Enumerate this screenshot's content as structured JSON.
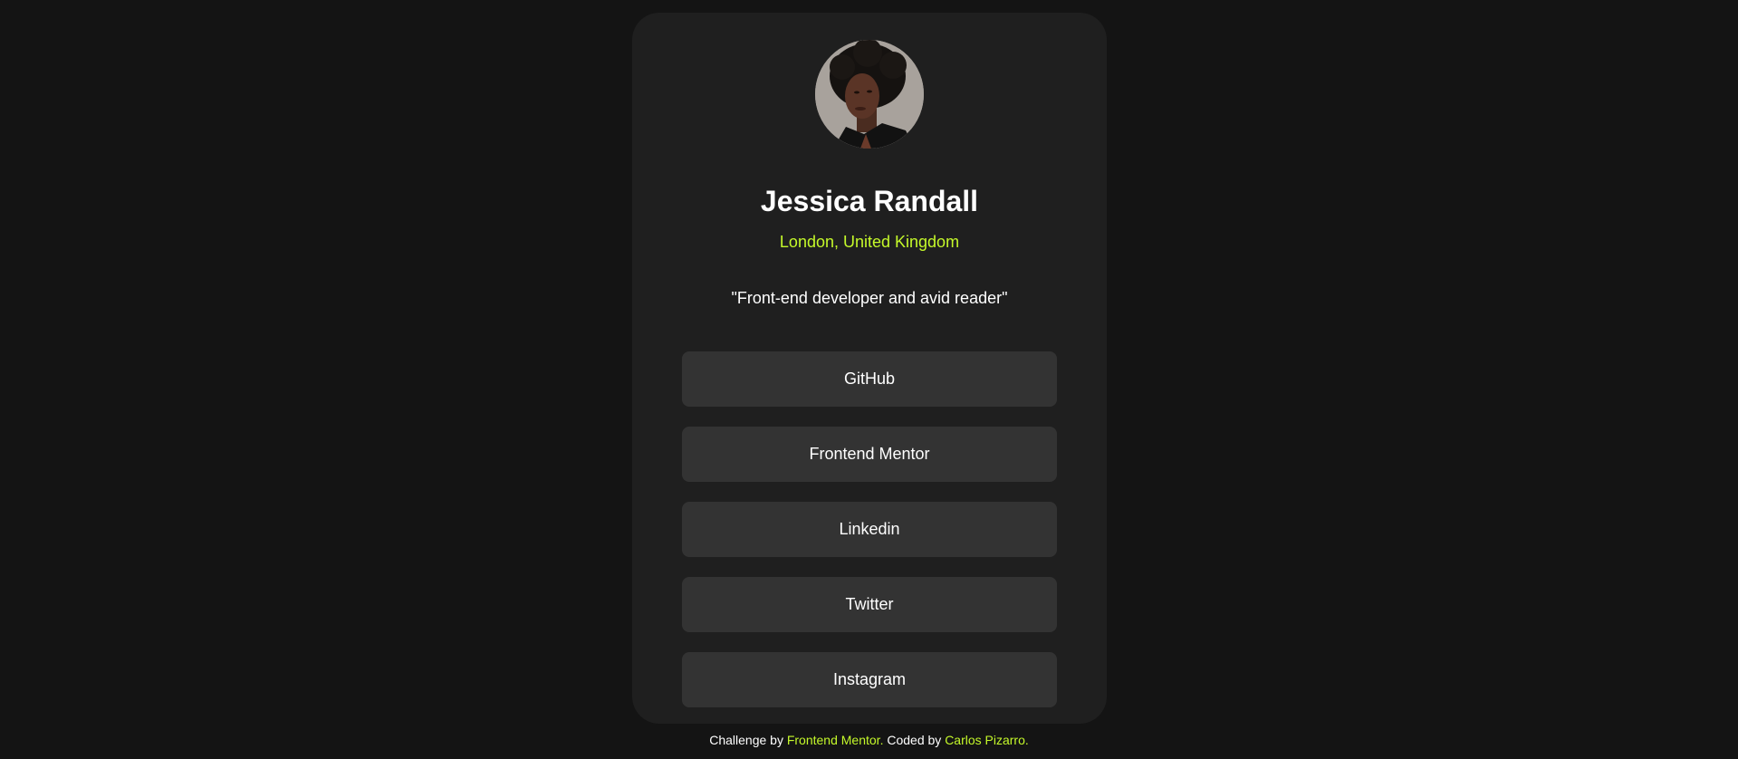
{
  "colors": {
    "background": "#141414",
    "card": "#1f1f1f",
    "button": "#333333",
    "accent": "#c4f82a",
    "text": "#ffffff"
  },
  "profile": {
    "avatar_icon": "profile-photo",
    "name": "Jessica Randall",
    "location": "London, United Kingdom",
    "bio": "\"Front-end developer and avid reader\""
  },
  "links": [
    {
      "label": "GitHub"
    },
    {
      "label": "Frontend Mentor"
    },
    {
      "label": "Linkedin"
    },
    {
      "label": "Twitter"
    },
    {
      "label": "Instagram"
    }
  ],
  "footer": {
    "prefix": "Challenge by ",
    "challenge_link": "Frontend Mentor.",
    "middle": " Coded by ",
    "author_link": "Carlos Pizarro."
  }
}
